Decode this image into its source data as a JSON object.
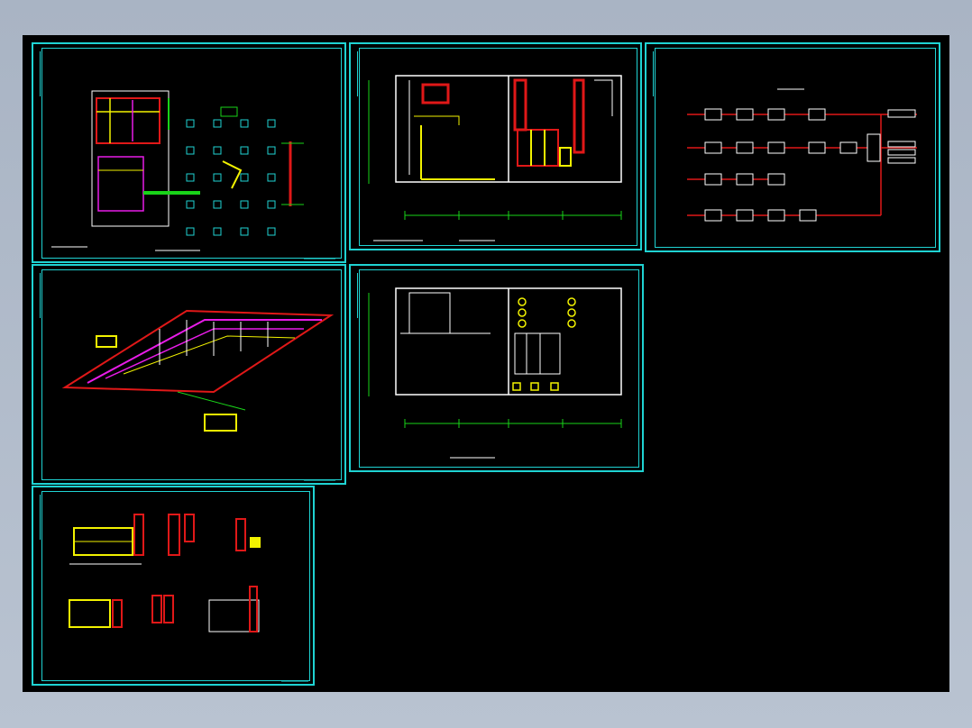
{
  "viewer": {
    "background": "#000000",
    "frame_color": "#1fd3d3"
  },
  "sheets": [
    {
      "id": "sheet-1",
      "content": "floor-plan-with-column-grid"
    },
    {
      "id": "sheet-2",
      "content": "equipment-room-plan-piping"
    },
    {
      "id": "sheet-3",
      "content": "system-flow-diagram"
    },
    {
      "id": "sheet-4",
      "content": "isometric-piping-system"
    },
    {
      "id": "sheet-5",
      "content": "equipment-room-plan-layout"
    },
    {
      "id": "sheet-6",
      "content": "detail-sections"
    }
  ],
  "colors": {
    "red": "#e01818",
    "yellow": "#f2f200",
    "white": "#ffffff",
    "green": "#19d419",
    "cyan": "#1fd3d3",
    "magenta": "#e81ce8"
  }
}
